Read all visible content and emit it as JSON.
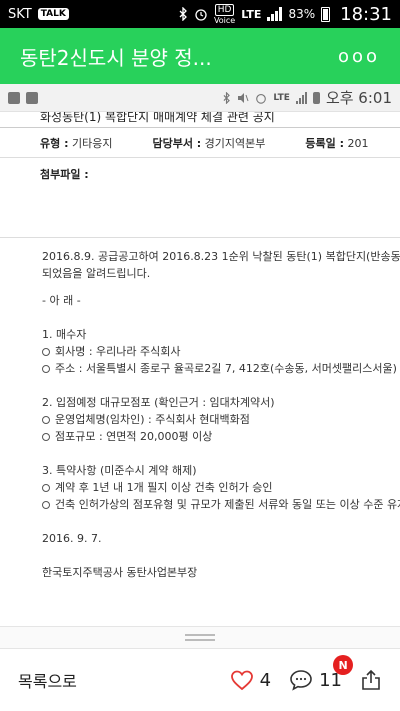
{
  "statusbar": {
    "carrier": "SKT",
    "talk_label": "TALK",
    "hd_label": "HD",
    "voice_label": "Voice",
    "lte_label": "LTE",
    "battery": "83%",
    "time": "18:31"
  },
  "appbar": {
    "title": "동탄2신도시 분양 정...",
    "more_label": "ooo"
  },
  "inner_status": {
    "lte_label": "LTE",
    "time": "오후 6:01"
  },
  "document": {
    "title": "화성동탄(1) 복합단지 매매계약 체결 관련 공지",
    "type_label": "유형 :",
    "type_value": "기타응지",
    "dept_label": "담당부서 :",
    "dept_value": "경기지역본부",
    "date_label": "등록일 :",
    "date_value": "201",
    "attach_label": "첨부파일 :",
    "body": {
      "intro1": "2016.8.9. 공급공고하여 2016.8.23 1순위 낙찰된 동탄(1) 복합단지(반송동 94,95,99번",
      "intro2": "되었음을 알려드립니다.",
      "below": "- 아 래 -",
      "s1_title": "1. 매수자",
      "s1_a": "회사명 : 우리나라 주식회사",
      "s1_b": "주소 : 서울특별시 종로구 율곡로2길 7, 412호(수송동, 서머셋팰리스서울)",
      "s2_title": "2. 입점예정 대규모점포 (확인근거 : 임대차계약서)",
      "s2_a": "운영업체명(임차인) : 주식회사 현대백화점",
      "s2_b": "점포규모 : 연면적 20,000평 이상",
      "s3_title": "3. 특약사항 (미준수시 계약 해제)",
      "s3_a": "계약 후 1년 내 1개 필지 이상 건축 인허가 승인",
      "s3_b": "건축 인허가상의 점포유형 및 규모가 제출된 서류와 동일 또는 이상 수준 유지",
      "date": "2016. 9. 7.",
      "signer": "한국토지주택공사 동탄사업본부장"
    }
  },
  "bottombar": {
    "list_label": "목록으로",
    "like_count": "4",
    "comment_count": "11",
    "new_badge": "N"
  },
  "colors": {
    "appbar": "#28d15b",
    "badge": "#e52020",
    "heart": "#e53935"
  }
}
